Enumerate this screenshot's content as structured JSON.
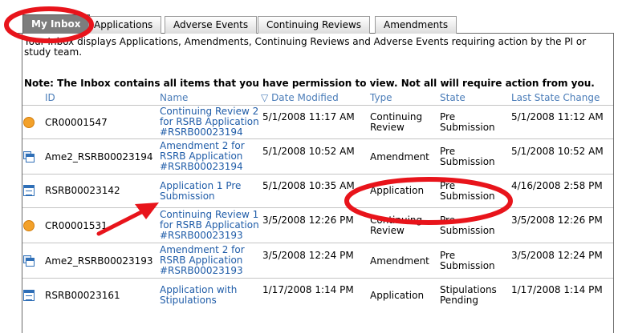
{
  "tabs": [
    {
      "label": "My Inbox",
      "active": true
    },
    {
      "label": "Applications",
      "active": false
    },
    {
      "label": "Adverse Events",
      "active": false
    },
    {
      "label": "Continuing Reviews",
      "active": false
    },
    {
      "label": "Amendments",
      "active": false
    }
  ],
  "inbox": {
    "intro": "Your Inbox displays Applications, Amendments, Continuing Reviews and Adverse Events requiring action by the PI or study team.",
    "note": "Note: The Inbox contains all items that you have permission to view. Not all will require action from you."
  },
  "columns": {
    "id": "ID",
    "name": "Name",
    "date_modified": "Date Modified",
    "sort_indicator": "▽",
    "type": "Type",
    "state": "State",
    "last_state_change": "Last State Change"
  },
  "rows": [
    {
      "icon": "continuing-review-icon",
      "id": "CR00001547",
      "name": "Continuing Review 2 for RSRB Application #RSRB00023194",
      "date": "5/1/2008 11:17 AM",
      "type": "Continuing Review",
      "state": "Pre Submission",
      "last": "5/1/2008 11:12 AM"
    },
    {
      "icon": "amendment-icon",
      "id": "Ame2_RSRB00023194",
      "name": "Amendment 2 for RSRB Application #RSRB00023194",
      "date": "5/1/2008 10:52 AM",
      "type": "Amendment",
      "state": "Pre Submission",
      "last": "5/1/2008 10:52 AM"
    },
    {
      "icon": "application-icon",
      "id": "RSRB00023142",
      "name": "Application 1 Pre Submission",
      "date": "5/1/2008 10:35 AM",
      "type": "Application",
      "state": "Pre Submission",
      "last": "4/16/2008 2:58 PM"
    },
    {
      "icon": "continuing-review-icon",
      "id": "CR00001531",
      "name": "Continuing Review 1 for RSRB Application #RSRB00023193",
      "date": "3/5/2008 12:26 PM",
      "type": "Continuing Review",
      "state": "Pre Submission",
      "last": "3/5/2008 12:26 PM"
    },
    {
      "icon": "amendment-icon",
      "id": "Ame2_RSRB00023193",
      "name": "Amendment 2 for RSRB Application #RSRB00023193",
      "date": "3/5/2008 12:24 PM",
      "type": "Amendment",
      "state": "Pre Submission",
      "last": "3/5/2008 12:24 PM"
    },
    {
      "icon": "application-icon",
      "id": "RSRB00023161",
      "name": "Application with Stipulations",
      "date": "1/17/2008 1:14 PM",
      "type": "Application",
      "state": "Stipulations Pending",
      "last": "1/17/2008 1:14 PM"
    }
  ],
  "colors": {
    "annotation_red": "#e8141b",
    "link_blue": "#1f5ca8",
    "header_blue": "#4a7cb8",
    "status_orange": "#f3a12a"
  }
}
